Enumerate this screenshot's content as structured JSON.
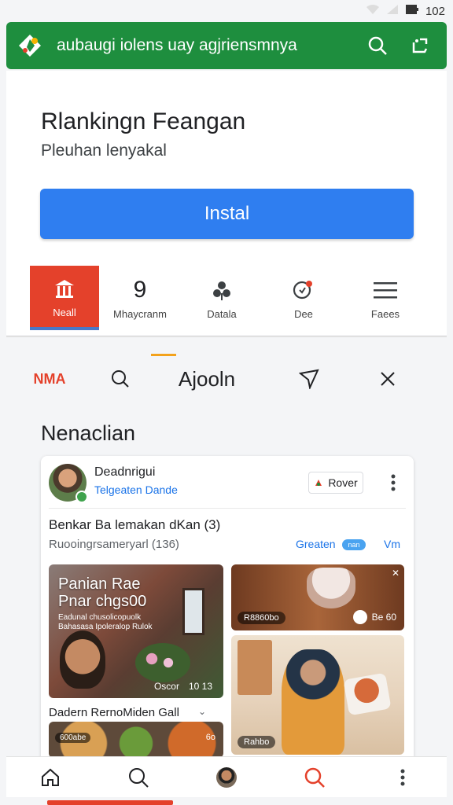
{
  "status_bar": {
    "time": "102"
  },
  "appbar": {
    "title": "aubaugi iolens uay agjriensmnya",
    "color": "#1e8e3e"
  },
  "hero": {
    "title": "Rlankingn Feangan",
    "subtitle": "Pleuhan lenyakal",
    "install_label": "Instal"
  },
  "shortcuts": [
    {
      "label": "Neall",
      "icon": "store-icon",
      "active": true
    },
    {
      "label": "Mhaycranm",
      "icon": "number-icon",
      "active": false
    },
    {
      "label": "Datala",
      "icon": "fan-icon",
      "active": false
    },
    {
      "label": "Dee",
      "icon": "chat-bubble-icon",
      "active": false
    },
    {
      "label": "Faees",
      "icon": "menu-icon",
      "active": false
    }
  ],
  "tabs": [
    {
      "label": "NMA"
    },
    {
      "label": "",
      "icon": "search-icon"
    },
    {
      "label": "Ajooln"
    },
    {
      "label": "",
      "icon": "send-icon"
    },
    {
      "label": "",
      "icon": "close-icon"
    }
  ],
  "section": {
    "title": "Nenaclian"
  },
  "card": {
    "author": "Deadnrigui",
    "author_sub": "Telgeaten Dande",
    "follow_label": "Rover",
    "post_title": "Benkar Ba lemakan dKan (3)",
    "post_sub": "Ruooingrsameryarl (136)",
    "post_link": "Greaten",
    "post_tag": "nan",
    "post_more": "Vm",
    "big_image": {
      "title_line1": "Panian Rae",
      "title_line2": "Pnar chgs00",
      "small_text": "Eadunal chusolicopuolk Bahasasa Ipoleralop Rulok",
      "footer_left": "Oscor",
      "footer_right": "10 13"
    },
    "cone_image": {
      "pill": "R8860bo",
      "right": "Be 60"
    },
    "woman_image": {
      "pill": "Rahbo"
    },
    "caption": "Dadern RernoMiden Gall",
    "food_image": {
      "pill": "600abe",
      "right": "6o"
    }
  },
  "bottom_nav": [
    {
      "icon": "home-icon"
    },
    {
      "icon": "search-icon"
    },
    {
      "icon": "avatar"
    },
    {
      "icon": "search-active-icon"
    },
    {
      "icon": "more-vertical-icon"
    }
  ],
  "colors": {
    "accent_red": "#e4412b",
    "install_blue": "#2f7ef0",
    "link_blue": "#1a73e8"
  }
}
